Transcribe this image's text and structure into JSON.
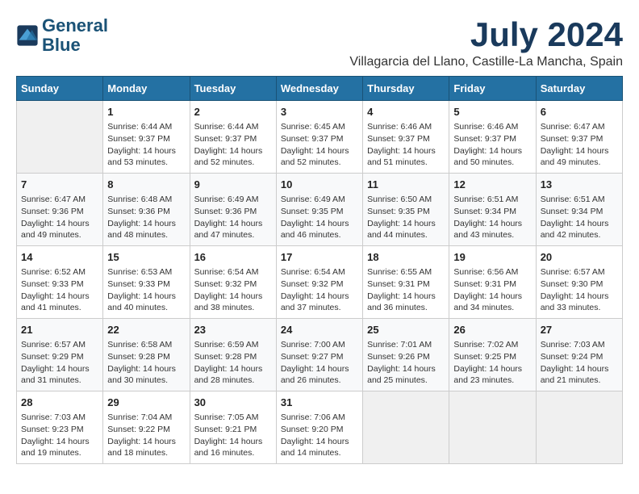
{
  "header": {
    "logo_line1": "General",
    "logo_line2": "Blue",
    "month_year": "July 2024",
    "location": "Villagarcia del Llano, Castille-La Mancha, Spain"
  },
  "calendar": {
    "days_of_week": [
      "Sunday",
      "Monday",
      "Tuesday",
      "Wednesday",
      "Thursday",
      "Friday",
      "Saturday"
    ],
    "weeks": [
      [
        {
          "day": "",
          "empty": true
        },
        {
          "day": "1",
          "sunrise": "6:44 AM",
          "sunset": "9:37 PM",
          "daylight": "14 hours and 53 minutes."
        },
        {
          "day": "2",
          "sunrise": "6:44 AM",
          "sunset": "9:37 PM",
          "daylight": "14 hours and 52 minutes."
        },
        {
          "day": "3",
          "sunrise": "6:45 AM",
          "sunset": "9:37 PM",
          "daylight": "14 hours and 52 minutes."
        },
        {
          "day": "4",
          "sunrise": "6:46 AM",
          "sunset": "9:37 PM",
          "daylight": "14 hours and 51 minutes."
        },
        {
          "day": "5",
          "sunrise": "6:46 AM",
          "sunset": "9:37 PM",
          "daylight": "14 hours and 50 minutes."
        },
        {
          "day": "6",
          "sunrise": "6:47 AM",
          "sunset": "9:37 PM",
          "daylight": "14 hours and 49 minutes."
        }
      ],
      [
        {
          "day": "7",
          "sunrise": "6:47 AM",
          "sunset": "9:36 PM",
          "daylight": "14 hours and 49 minutes."
        },
        {
          "day": "8",
          "sunrise": "6:48 AM",
          "sunset": "9:36 PM",
          "daylight": "14 hours and 48 minutes."
        },
        {
          "day": "9",
          "sunrise": "6:49 AM",
          "sunset": "9:36 PM",
          "daylight": "14 hours and 47 minutes."
        },
        {
          "day": "10",
          "sunrise": "6:49 AM",
          "sunset": "9:35 PM",
          "daylight": "14 hours and 46 minutes."
        },
        {
          "day": "11",
          "sunrise": "6:50 AM",
          "sunset": "9:35 PM",
          "daylight": "14 hours and 44 minutes."
        },
        {
          "day": "12",
          "sunrise": "6:51 AM",
          "sunset": "9:34 PM",
          "daylight": "14 hours and 43 minutes."
        },
        {
          "day": "13",
          "sunrise": "6:51 AM",
          "sunset": "9:34 PM",
          "daylight": "14 hours and 42 minutes."
        }
      ],
      [
        {
          "day": "14",
          "sunrise": "6:52 AM",
          "sunset": "9:33 PM",
          "daylight": "14 hours and 41 minutes."
        },
        {
          "day": "15",
          "sunrise": "6:53 AM",
          "sunset": "9:33 PM",
          "daylight": "14 hours and 40 minutes."
        },
        {
          "day": "16",
          "sunrise": "6:54 AM",
          "sunset": "9:32 PM",
          "daylight": "14 hours and 38 minutes."
        },
        {
          "day": "17",
          "sunrise": "6:54 AM",
          "sunset": "9:32 PM",
          "daylight": "14 hours and 37 minutes."
        },
        {
          "day": "18",
          "sunrise": "6:55 AM",
          "sunset": "9:31 PM",
          "daylight": "14 hours and 36 minutes."
        },
        {
          "day": "19",
          "sunrise": "6:56 AM",
          "sunset": "9:31 PM",
          "daylight": "14 hours and 34 minutes."
        },
        {
          "day": "20",
          "sunrise": "6:57 AM",
          "sunset": "9:30 PM",
          "daylight": "14 hours and 33 minutes."
        }
      ],
      [
        {
          "day": "21",
          "sunrise": "6:57 AM",
          "sunset": "9:29 PM",
          "daylight": "14 hours and 31 minutes."
        },
        {
          "day": "22",
          "sunrise": "6:58 AM",
          "sunset": "9:28 PM",
          "daylight": "14 hours and 30 minutes."
        },
        {
          "day": "23",
          "sunrise": "6:59 AM",
          "sunset": "9:28 PM",
          "daylight": "14 hours and 28 minutes."
        },
        {
          "day": "24",
          "sunrise": "7:00 AM",
          "sunset": "9:27 PM",
          "daylight": "14 hours and 26 minutes."
        },
        {
          "day": "25",
          "sunrise": "7:01 AM",
          "sunset": "9:26 PM",
          "daylight": "14 hours and 25 minutes."
        },
        {
          "day": "26",
          "sunrise": "7:02 AM",
          "sunset": "9:25 PM",
          "daylight": "14 hours and 23 minutes."
        },
        {
          "day": "27",
          "sunrise": "7:03 AM",
          "sunset": "9:24 PM",
          "daylight": "14 hours and 21 minutes."
        }
      ],
      [
        {
          "day": "28",
          "sunrise": "7:03 AM",
          "sunset": "9:23 PM",
          "daylight": "14 hours and 19 minutes."
        },
        {
          "day": "29",
          "sunrise": "7:04 AM",
          "sunset": "9:22 PM",
          "daylight": "14 hours and 18 minutes."
        },
        {
          "day": "30",
          "sunrise": "7:05 AM",
          "sunset": "9:21 PM",
          "daylight": "14 hours and 16 minutes."
        },
        {
          "day": "31",
          "sunrise": "7:06 AM",
          "sunset": "9:20 PM",
          "daylight": "14 hours and 14 minutes."
        },
        {
          "day": "",
          "empty": true
        },
        {
          "day": "",
          "empty": true
        },
        {
          "day": "",
          "empty": true
        }
      ]
    ]
  }
}
